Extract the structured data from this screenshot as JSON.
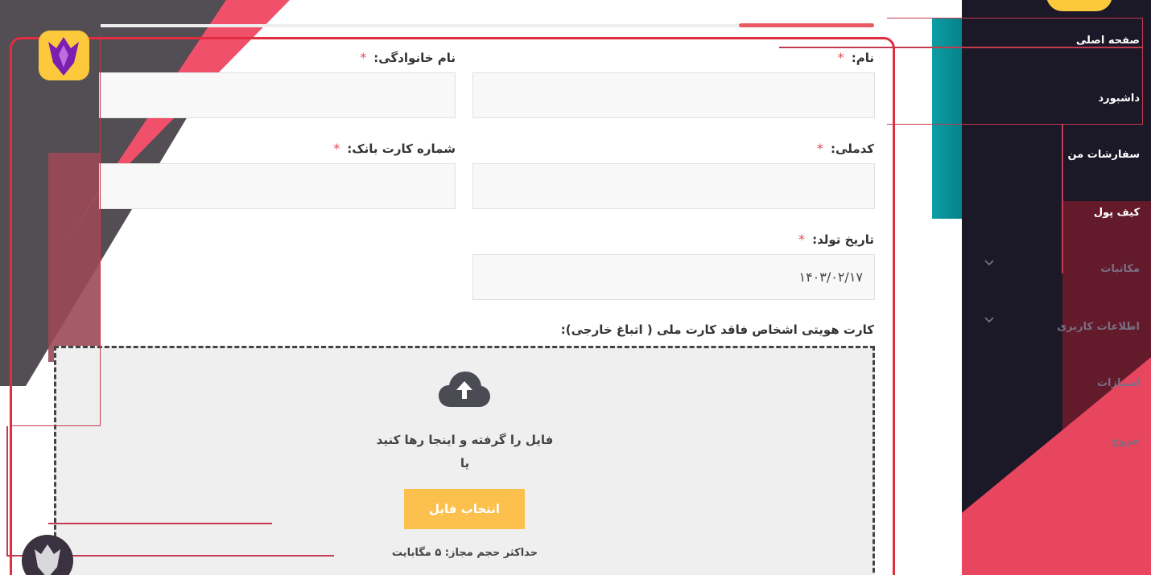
{
  "sidebar": {
    "items": [
      {
        "label": "صفحه اصلی",
        "active": true
      },
      {
        "label": "داشبورد",
        "active": true
      },
      {
        "label": "سفارشات من",
        "active": true
      },
      {
        "label": "کیف پول",
        "active": true
      },
      {
        "label": "مکاتبات",
        "active": false,
        "expandable": true
      },
      {
        "label": "اطلاعات کاربری",
        "active": false,
        "expandable": true
      },
      {
        "label": "امتیازات",
        "active": false
      },
      {
        "label": "خروج",
        "active": false
      }
    ]
  },
  "form": {
    "first_name": {
      "label": "نام:",
      "required": "*",
      "value": ""
    },
    "last_name": {
      "label": "نام خانوادگی:",
      "required": "*",
      "value": ""
    },
    "national_code": {
      "label": "کدملی:",
      "required": "*",
      "value": ""
    },
    "bank_card": {
      "label": "شماره کارت بانک:",
      "required": "*",
      "value": ""
    },
    "birth_date": {
      "label": "تاریخ تولد:",
      "required": "*",
      "value": "۱۴۰۳/۰۲/۱۷"
    },
    "id_card": {
      "label": "کارت هویتی اشخاص فاقد کارت ملی ( اتباغ خارجی):"
    }
  },
  "upload": {
    "drop_text": "فایل را گرفته و اینجا رها کنید",
    "or_text": "یا",
    "button_label": "انتخاب فایل",
    "max_size": "حداکثر حجم مجاز: ۵ مگابایت",
    "icon": "cloud-upload-icon"
  },
  "colors": {
    "accent": "#e02d3f",
    "button": "#fcc14d",
    "sidebar_bg": "#1b1827",
    "required_star": "#e24a55"
  }
}
